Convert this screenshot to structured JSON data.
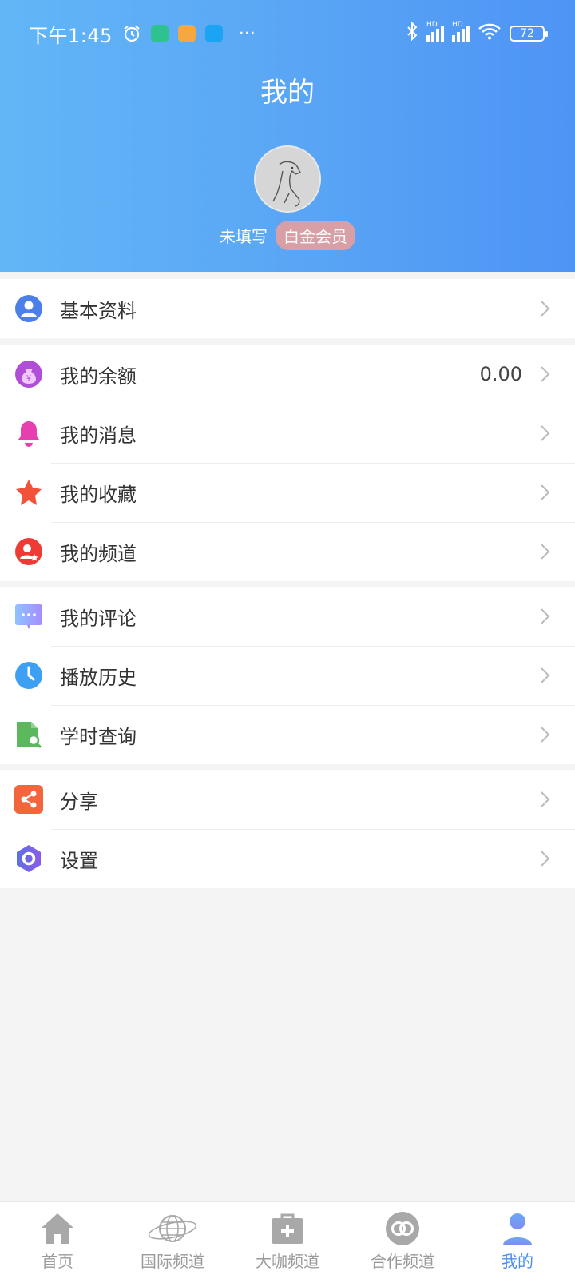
{
  "status_bar": {
    "time": "下午1:45",
    "network_label_1": "HD",
    "network_label_2": "HD",
    "battery": "72",
    "more": "···"
  },
  "header": {
    "title": "我的",
    "user_name": "未填写",
    "vip_badge": "白金会员"
  },
  "profile_section": {
    "basic_info": "基本资料"
  },
  "account_section": {
    "balance_label": "我的余额",
    "balance_value": "0.00",
    "messages": "我的消息",
    "favorites": "我的收藏",
    "channels": "我的频道"
  },
  "activity_section": {
    "comments": "我的评论",
    "history": "播放历史",
    "study_hours": "学时查询"
  },
  "misc_section": {
    "share": "分享",
    "settings": "设置"
  },
  "tabbar": {
    "tabs": [
      {
        "label": "首页",
        "icon": "home-icon"
      },
      {
        "label": "国际频道",
        "icon": "globe-icon"
      },
      {
        "label": "大咖频道",
        "icon": "medkit-icon"
      },
      {
        "label": "合作频道",
        "icon": "link-icon"
      },
      {
        "label": "我的",
        "icon": "user-icon",
        "active": true
      }
    ]
  },
  "colors": {
    "header_start": "#62b6f6",
    "header_end": "#4e94f5",
    "active_tab": "#4a8ff0",
    "vip_badge": "#d8a0a6"
  }
}
